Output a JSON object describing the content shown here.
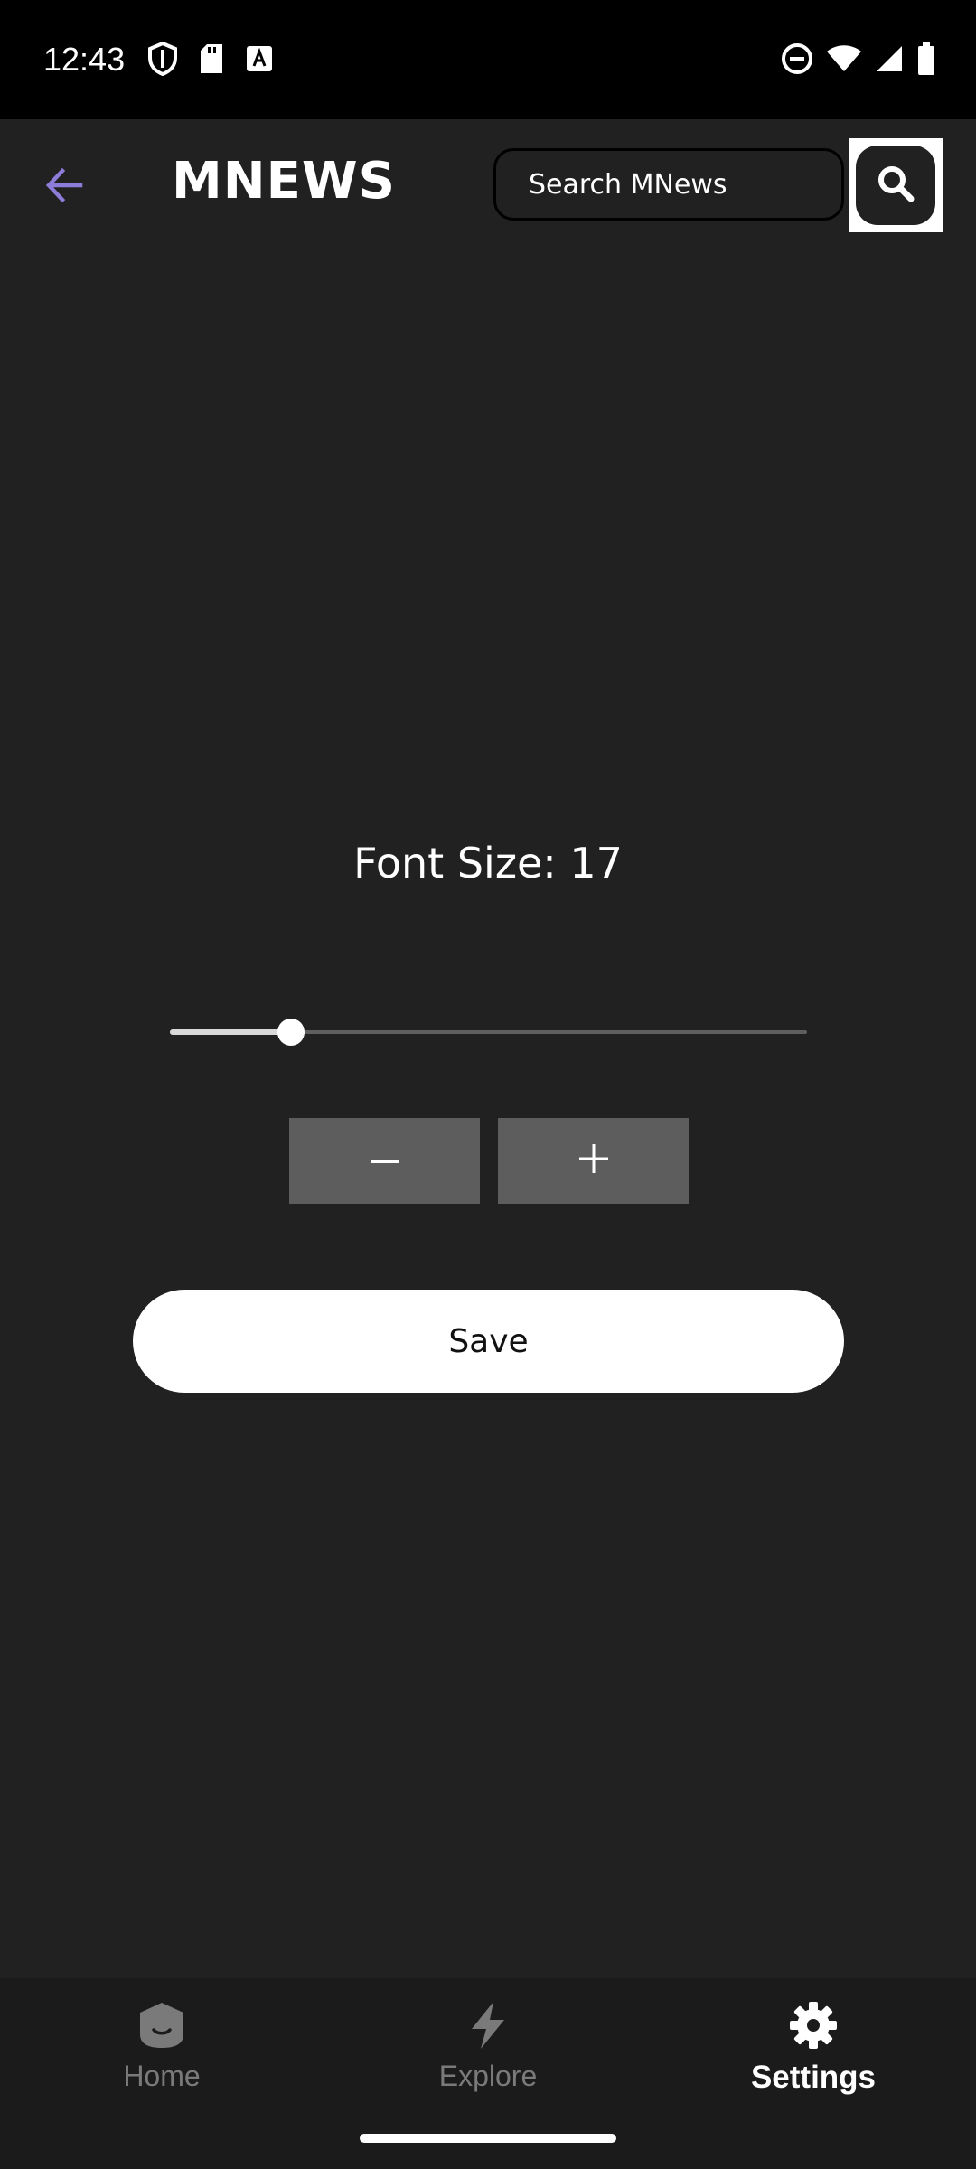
{
  "status_bar": {
    "time": "12:43"
  },
  "app_bar": {
    "title": "MNEWS",
    "search_placeholder": "Search MNews"
  },
  "settings": {
    "font_size_label": "Font Size: 17",
    "slider_fraction": 0.19,
    "minus_label": "−",
    "plus_label": "+",
    "save_label": "Save"
  },
  "bottom_nav": {
    "items": [
      {
        "label": "Home",
        "icon": "home-icon",
        "active": false
      },
      {
        "label": "Explore",
        "icon": "lightning-icon",
        "active": false
      },
      {
        "label": "Settings",
        "icon": "gear-icon",
        "active": true
      }
    ]
  },
  "colors": {
    "background": "#212121",
    "accent_back_arrow": "#8e7cd9",
    "button_gray": "#5d5d5d",
    "nav_inactive": "#7a7a7a",
    "nav_active": "#ffffff"
  }
}
